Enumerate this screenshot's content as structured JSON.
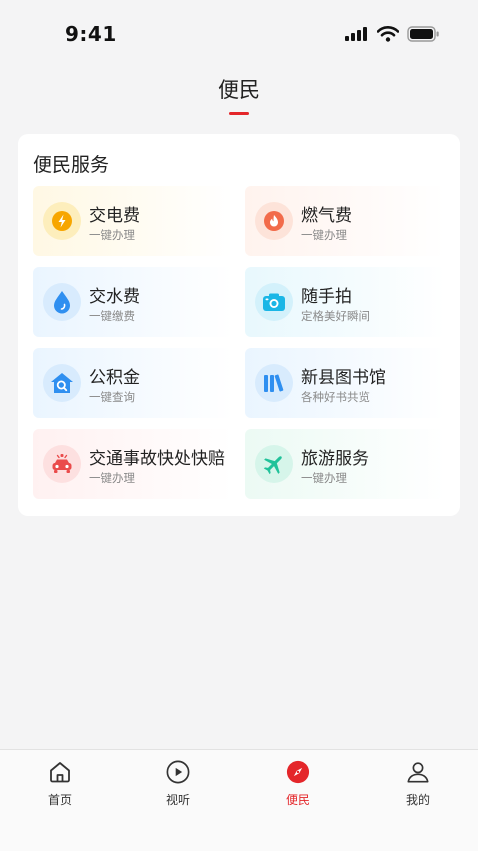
{
  "status_bar": {
    "time": "9:41"
  },
  "header": {
    "title": "便民"
  },
  "section": {
    "title": "便民服务",
    "services": [
      {
        "name": "交电费",
        "subtitle": "一键办理",
        "icon": "lightning-icon",
        "color": "#f7a600"
      },
      {
        "name": "燃气费",
        "subtitle": "一键办理",
        "icon": "flame-icon",
        "color": "#f26b4a"
      },
      {
        "name": "交水费",
        "subtitle": "一键缴费",
        "icon": "water-drop-icon",
        "color": "#2f8ff0"
      },
      {
        "name": "随手拍",
        "subtitle": "定格美好瞬间",
        "icon": "camera-icon",
        "color": "#1ab6e6"
      },
      {
        "name": "公积金",
        "subtitle": "一键查询",
        "icon": "house-search-icon",
        "color": "#2f8ff0"
      },
      {
        "name": "新县图书馆",
        "subtitle": "各种好书共览",
        "icon": "books-icon",
        "color": "#2f8ff0"
      },
      {
        "name": "交通事故快处快赔",
        "subtitle": "一键办理",
        "icon": "car-accident-icon",
        "color": "#ea4b4b"
      },
      {
        "name": "旅游服务",
        "subtitle": "一键办理",
        "icon": "airplane-icon",
        "color": "#21c29a"
      }
    ]
  },
  "tabbar": {
    "active": "便民",
    "accent_color": "#e4262a",
    "tabs": [
      {
        "label": "首页",
        "icon": "home-icon"
      },
      {
        "label": "视听",
        "icon": "play-icon"
      },
      {
        "label": "便民",
        "icon": "compass-icon"
      },
      {
        "label": "我的",
        "icon": "user-icon"
      }
    ]
  }
}
